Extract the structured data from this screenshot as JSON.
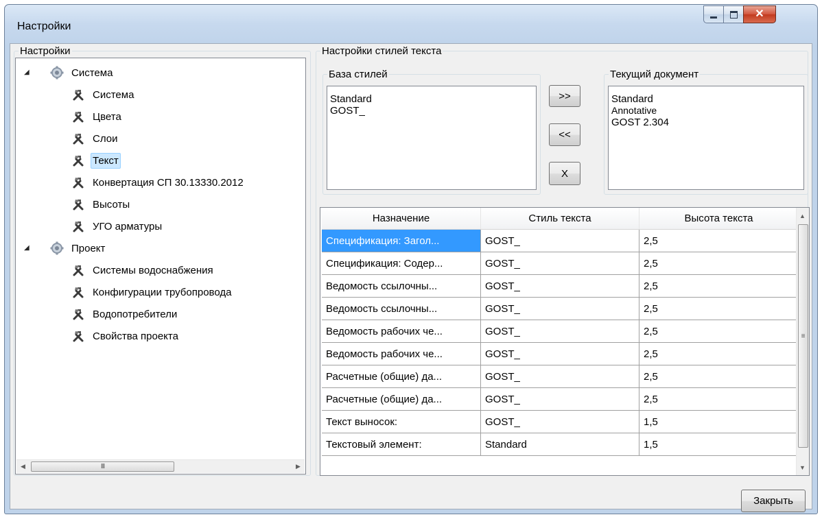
{
  "window": {
    "title": "Настройки"
  },
  "left_group": {
    "label": "Настройки"
  },
  "tree": [
    {
      "label": "Система",
      "level": 0,
      "icon": "gear-icon",
      "expanded": true
    },
    {
      "label": "Система",
      "level": 1,
      "icon": "tools-icon"
    },
    {
      "label": "Цвета",
      "level": 1,
      "icon": "tools-icon"
    },
    {
      "label": "Слои",
      "level": 1,
      "icon": "tools-icon"
    },
    {
      "label": "Текст",
      "level": 1,
      "icon": "tools-icon",
      "selected": true
    },
    {
      "label": "Конвертация СП 30.13330.2012",
      "level": 1,
      "icon": "tools-icon"
    },
    {
      "label": "Высоты",
      "level": 1,
      "icon": "tools-icon"
    },
    {
      "label": "УГО арматуры",
      "level": 1,
      "icon": "tools-icon"
    },
    {
      "label": "Проект",
      "level": 0,
      "icon": "gear-icon",
      "expanded": true
    },
    {
      "label": "Системы водоснабжения",
      "level": 1,
      "icon": "tools-icon"
    },
    {
      "label": "Конфигурации трубопровода",
      "level": 1,
      "icon": "tools-icon"
    },
    {
      "label": "Водопотребители",
      "level": 1,
      "icon": "tools-icon"
    },
    {
      "label": "Свойства проекта",
      "level": 1,
      "icon": "tools-icon"
    }
  ],
  "hscroll": {
    "thumb_grip": "III"
  },
  "right_group": {
    "label": "Настройки стилей текста"
  },
  "styles_base": {
    "label": "База стилей",
    "items": [
      "Standard",
      "GOST_"
    ]
  },
  "current_doc": {
    "label": "Текущий документ",
    "items": [
      "Standard",
      "Annotative",
      "GOST 2.304"
    ]
  },
  "buttons": {
    "add": ">>",
    "remove": "<<",
    "delete": "X",
    "close": "Закрыть"
  },
  "grid": {
    "columns": [
      "Назначение",
      "Стиль текста",
      "Высота текста"
    ],
    "rows": [
      [
        "Спецификация: Загол...",
        "GOST_",
        "2,5"
      ],
      [
        "Спецификация: Содер...",
        "GOST_",
        "2,5"
      ],
      [
        "Ведомость ссылочны...",
        "GOST_",
        "2,5"
      ],
      [
        "Ведомость ссылочны...",
        "GOST_",
        "2,5"
      ],
      [
        "Ведомость рабочих че...",
        "GOST_",
        "2,5"
      ],
      [
        "Ведомость рабочих че...",
        "GOST_",
        "2,5"
      ],
      [
        "Расчетные (общие) да...",
        "GOST_",
        "2,5"
      ],
      [
        "Расчетные (общие) да...",
        "GOST_",
        "2,5"
      ],
      [
        "Текст выносок:",
        "GOST_",
        "1,5"
      ],
      [
        "Текстовый элемент:",
        "Standard",
        "1,5"
      ]
    ],
    "selected_cell": [
      0,
      0
    ]
  }
}
